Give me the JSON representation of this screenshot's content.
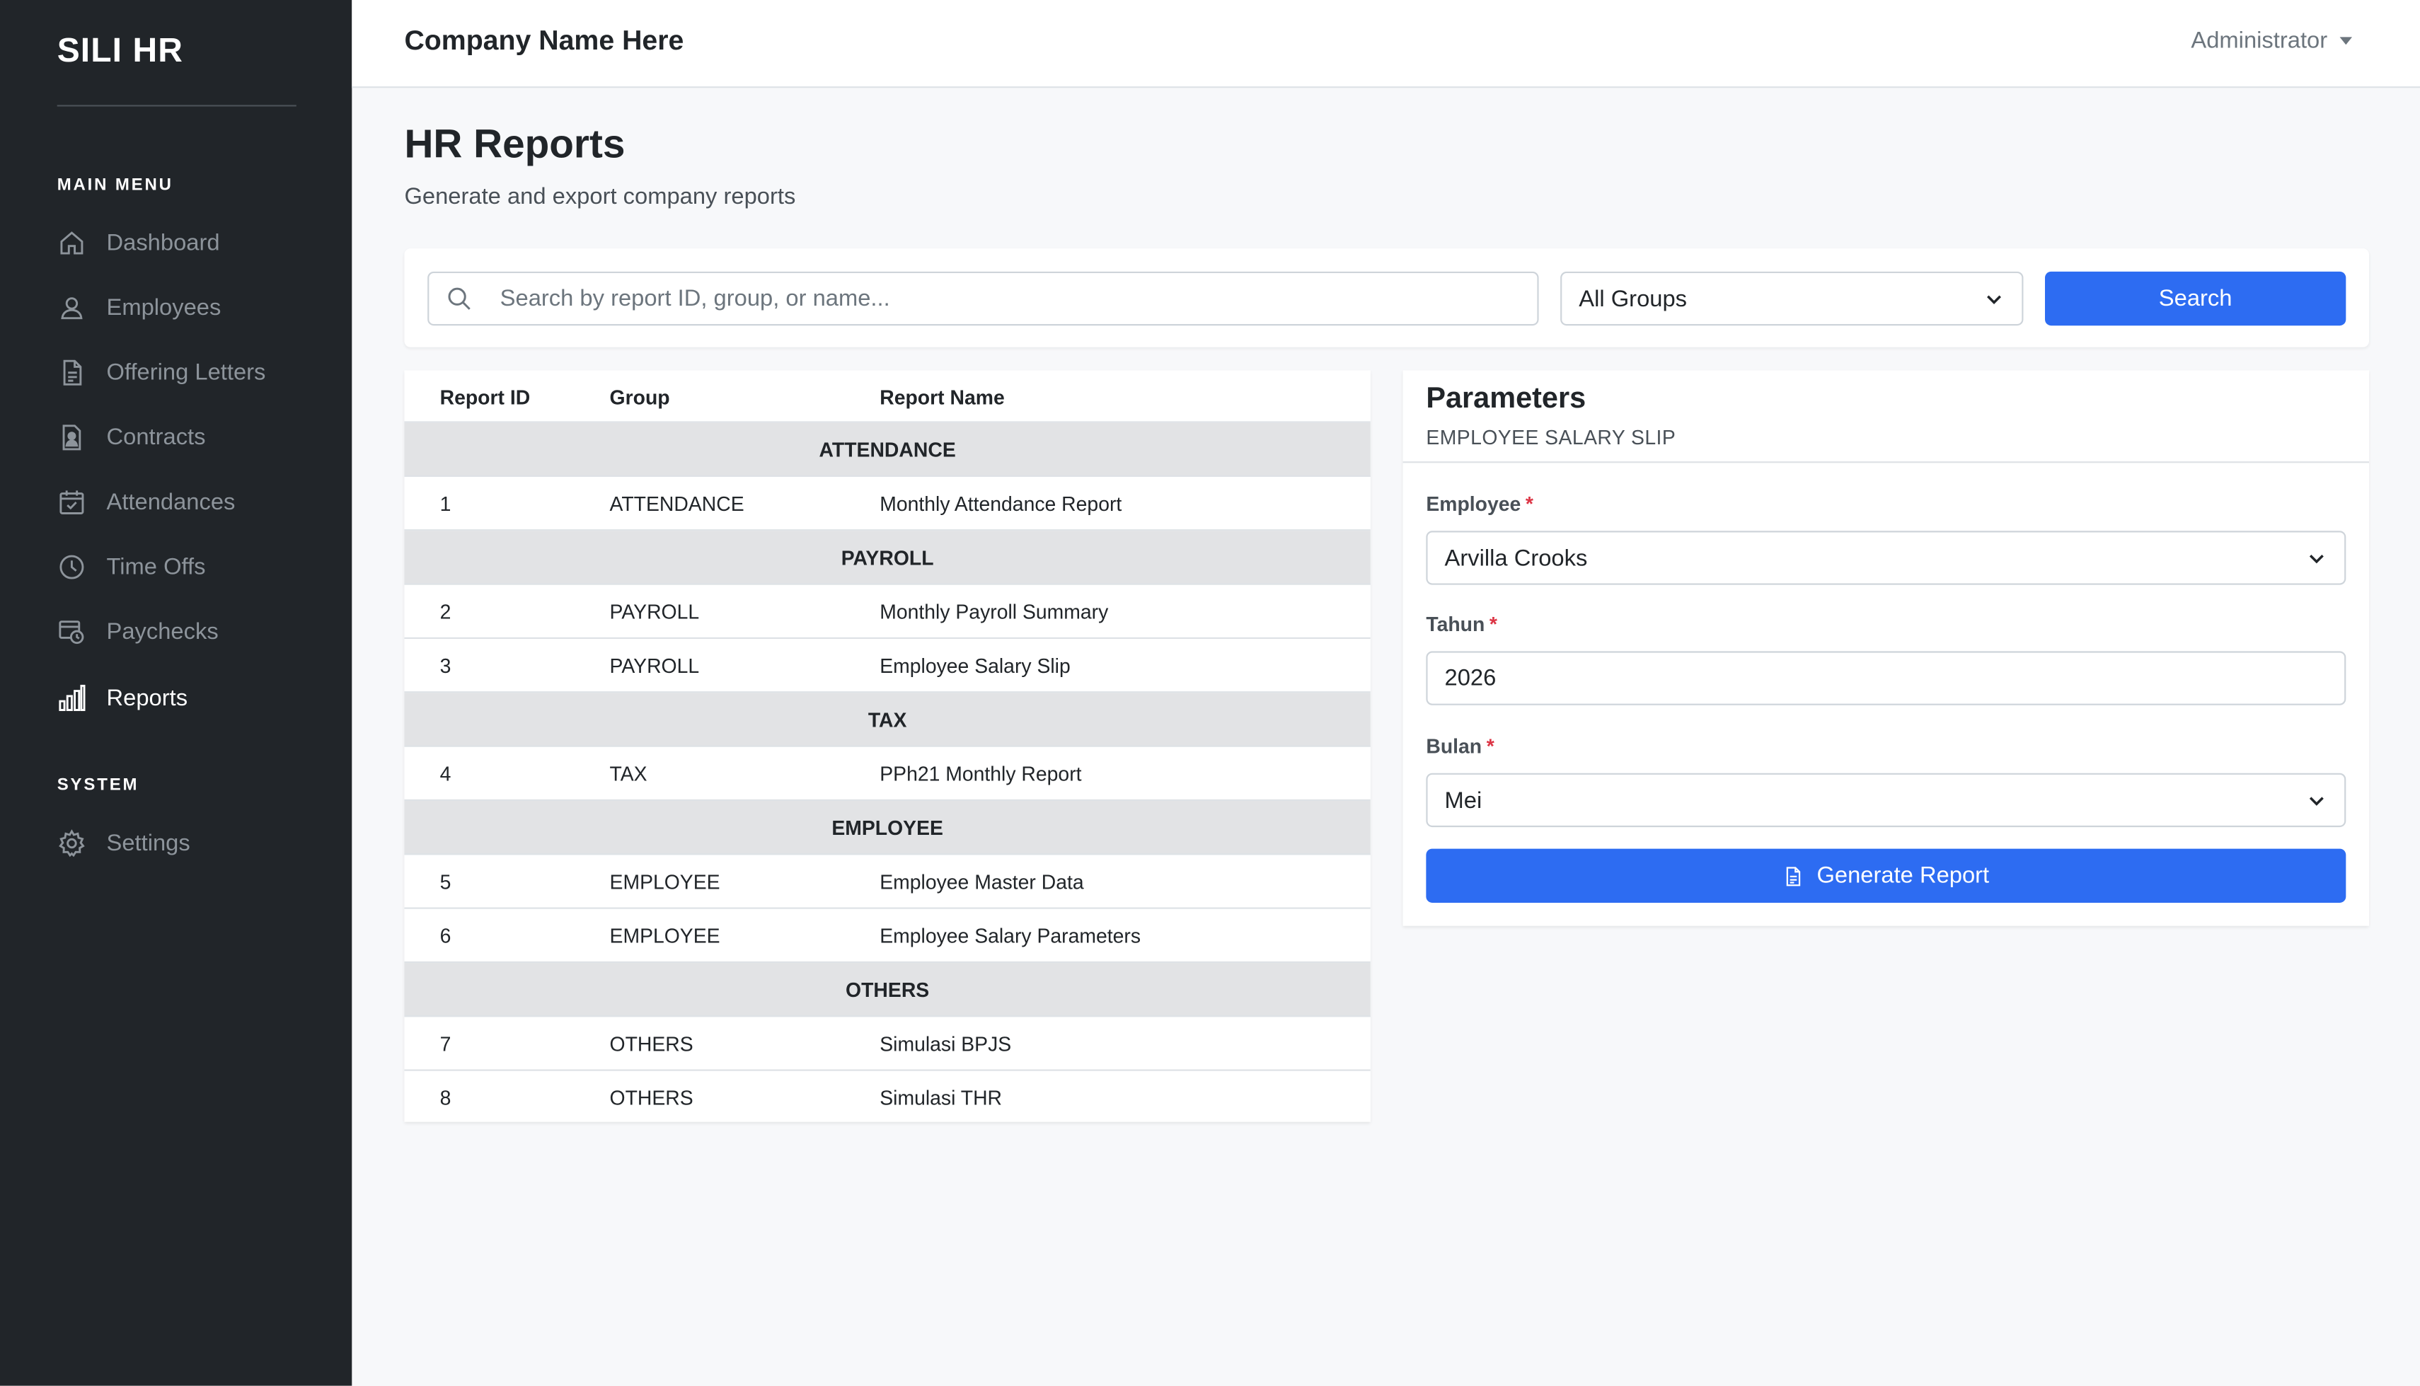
{
  "sidebar": {
    "brand": "SILI HR",
    "main_menu_label": "MAIN MENU",
    "system_label": "SYSTEM",
    "items": [
      {
        "label": "Dashboard",
        "icon": "home-icon"
      },
      {
        "label": "Employees",
        "icon": "user-icon"
      },
      {
        "label": "Offering Letters",
        "icon": "document-icon"
      },
      {
        "label": "Contracts",
        "icon": "contract-icon"
      },
      {
        "label": "Attendances",
        "icon": "calendar-check-icon"
      },
      {
        "label": "Time Offs",
        "icon": "clock-icon"
      },
      {
        "label": "Paychecks",
        "icon": "paycheck-icon"
      },
      {
        "label": "Reports",
        "icon": "bar-chart-icon",
        "active": true
      }
    ],
    "system_items": [
      {
        "label": "Settings",
        "icon": "gear-icon"
      }
    ]
  },
  "topbar": {
    "company": "Company Name Here",
    "user": "Administrator"
  },
  "page": {
    "title": "HR Reports",
    "subtitle": "Generate and export company reports"
  },
  "filters": {
    "search_placeholder": "Search by report ID, group, or name...",
    "search_value": "",
    "group_selected": "All Groups",
    "search_button": "Search"
  },
  "table": {
    "headers": [
      "Report ID",
      "Group",
      "Report Name"
    ],
    "groups": [
      {
        "name": "ATTENDANCE",
        "rows": [
          {
            "id": "1",
            "group": "ATTENDANCE",
            "name": "Monthly Attendance Report"
          }
        ]
      },
      {
        "name": "PAYROLL",
        "rows": [
          {
            "id": "2",
            "group": "PAYROLL",
            "name": "Monthly Payroll Summary"
          },
          {
            "id": "3",
            "group": "PAYROLL",
            "name": "Employee Salary Slip"
          }
        ]
      },
      {
        "name": "TAX",
        "rows": [
          {
            "id": "4",
            "group": "TAX",
            "name": "PPh21 Monthly Report"
          }
        ]
      },
      {
        "name": "EMPLOYEE",
        "rows": [
          {
            "id": "5",
            "group": "EMPLOYEE",
            "name": "Employee Master Data"
          },
          {
            "id": "6",
            "group": "EMPLOYEE",
            "name": "Employee Salary Parameters"
          }
        ]
      },
      {
        "name": "OTHERS",
        "rows": [
          {
            "id": "7",
            "group": "OTHERS",
            "name": "Simulasi BPJS"
          },
          {
            "id": "8",
            "group": "OTHERS",
            "name": "Simulasi THR"
          }
        ]
      }
    ]
  },
  "parameters": {
    "title": "Parameters",
    "subtitle": "EMPLOYEE SALARY SLIP",
    "employee_label": "Employee",
    "employee_value": "Arvilla Crooks",
    "year_label": "Tahun",
    "year_value": "2026",
    "month_label": "Bulan",
    "month_value": "Mei",
    "required_mark": "*",
    "generate_button": "Generate Report"
  },
  "colors": {
    "sidebar_bg": "#212529",
    "primary": "#2d6cf2",
    "group_row_bg": "#e2e3e5",
    "required": "#dc3545"
  }
}
